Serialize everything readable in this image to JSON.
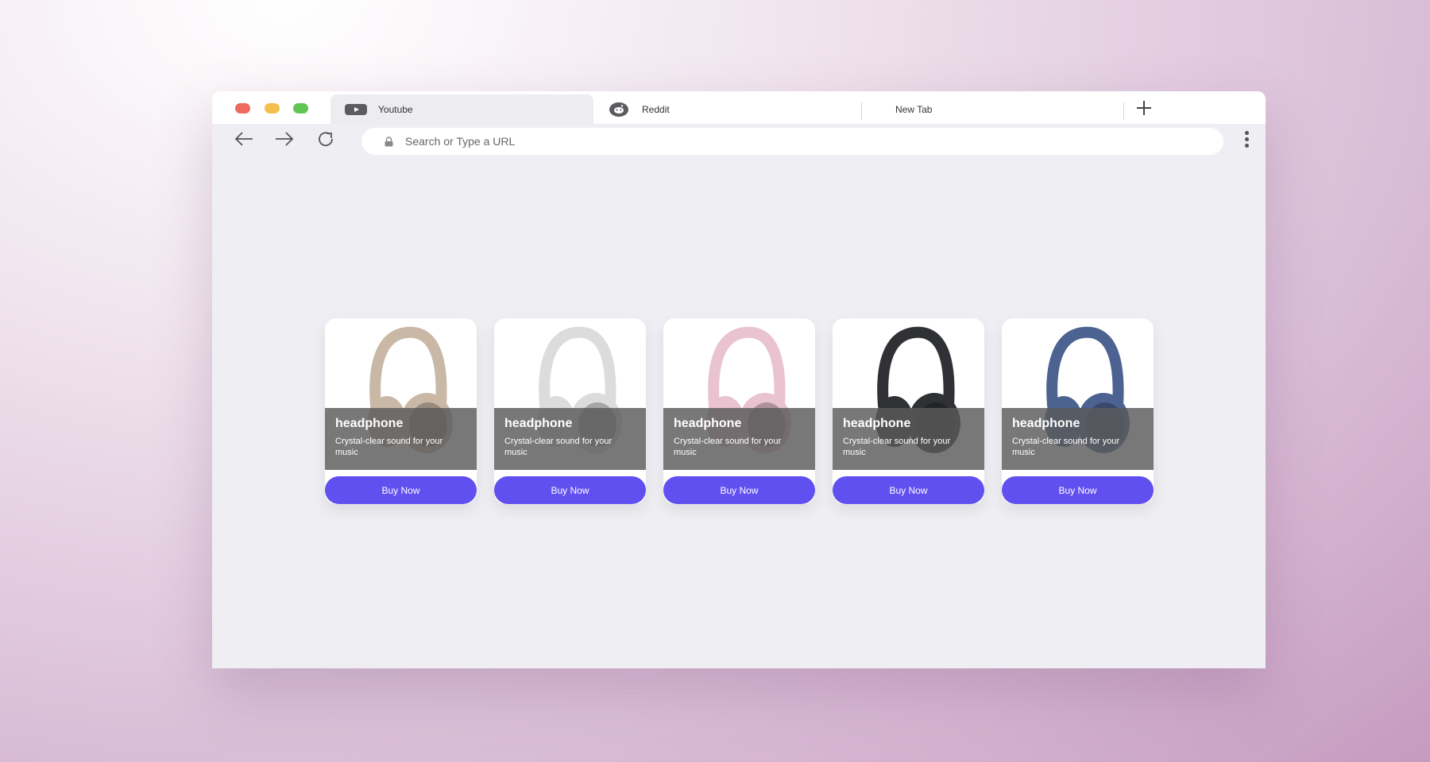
{
  "browser": {
    "tabs": [
      {
        "label": "Youtube",
        "icon": "youtube-icon",
        "active": true
      },
      {
        "label": "Reddit",
        "icon": "reddit-icon",
        "active": false
      },
      {
        "label": "New Tab",
        "icon": "",
        "active": false
      }
    ],
    "new_tab_icon": "plus-icon",
    "address": {
      "placeholder": "Search or Type a URL",
      "value": ""
    },
    "colors": {
      "traffic_close": "#ec6a5e",
      "traffic_minimize": "#f4bf4f",
      "traffic_maximize": "#61c554"
    }
  },
  "products": [
    {
      "title": "headphone",
      "description": "Crystal-clear sound for your music",
      "button": "Buy Now",
      "color": "#c9b8a6",
      "color_name": "beige"
    },
    {
      "title": "headphone",
      "description": "Crystal-clear sound for your music",
      "button": "Buy Now",
      "color": "#dcdcdc",
      "color_name": "white"
    },
    {
      "title": "headphone",
      "description": "Crystal-clear sound for your music",
      "button": "Buy Now",
      "color": "#e9c3cf",
      "color_name": "pink"
    },
    {
      "title": "headphone",
      "description": "Crystal-clear sound for your music",
      "button": "Buy Now",
      "color": "#2f3135",
      "color_name": "black"
    },
    {
      "title": "headphone",
      "description": "Crystal-clear sound for your music",
      "button": "Buy Now",
      "color": "#4c6290",
      "color_name": "blue"
    }
  ],
  "accent_color": "#6150f0"
}
